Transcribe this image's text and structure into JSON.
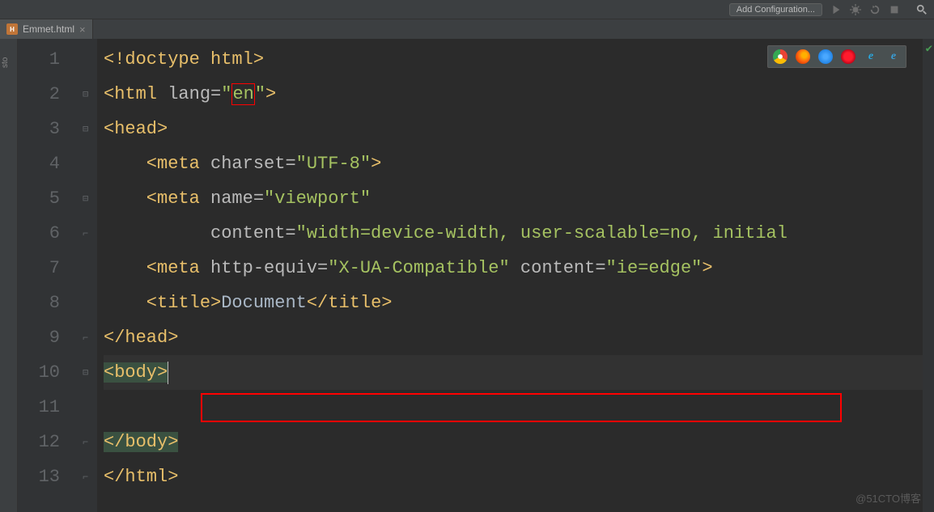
{
  "toolbar": {
    "addConfig": "Add Configuration..."
  },
  "tab": {
    "filename": "Emmet.html"
  },
  "sideStrip": "sto",
  "gutter": {
    "lines": [
      "1",
      "2",
      "3",
      "4",
      "5",
      "6",
      "7",
      "8",
      "9",
      "10",
      "11",
      "12",
      "13"
    ]
  },
  "code": {
    "l1": {
      "doctype": "<!doctype html>"
    },
    "l2": {
      "open": "<",
      "tag": "html",
      "attr": " lang=",
      "q": "\"",
      "val": "en",
      "close": ">"
    },
    "l3": {
      "open": "<",
      "tag": "head",
      "close": ">"
    },
    "l4": {
      "open": "    <",
      "tag": "meta",
      "attr1": " charset=",
      "q": "\"",
      "val1": "UTF-8",
      "close": ">"
    },
    "l5": {
      "open": "    <",
      "tag": "meta",
      "attr1": " name=",
      "q": "\"",
      "val1": "viewport"
    },
    "l6": {
      "attr": "          content=",
      "q": "\"",
      "val": "width=device-width, user-scalable=no, initial"
    },
    "l7": {
      "open": "    <",
      "tag": "meta",
      "attr1": " http-equiv=",
      "q": "\"",
      "val1": "X-UA-Compatible",
      "attr2": " content=",
      "val2": "ie=edge",
      "close": ">"
    },
    "l8": {
      "open": "    <",
      "tag": "title",
      "mid": ">",
      "text": "Document",
      "cls": "</",
      "close": ">"
    },
    "l9": {
      "open": "</",
      "tag": "head",
      "close": ">"
    },
    "l10": {
      "open": "<",
      "tag": "body",
      "close": ">"
    },
    "l12": {
      "open": "</",
      "tag": "body",
      "close": ">"
    },
    "l13": {
      "open": "</",
      "tag": "html",
      "close": ">"
    }
  },
  "browserIcons": [
    "chrome",
    "firefox",
    "safari",
    "opera",
    "ie",
    "edge"
  ],
  "watermark": "@51CTO博客"
}
